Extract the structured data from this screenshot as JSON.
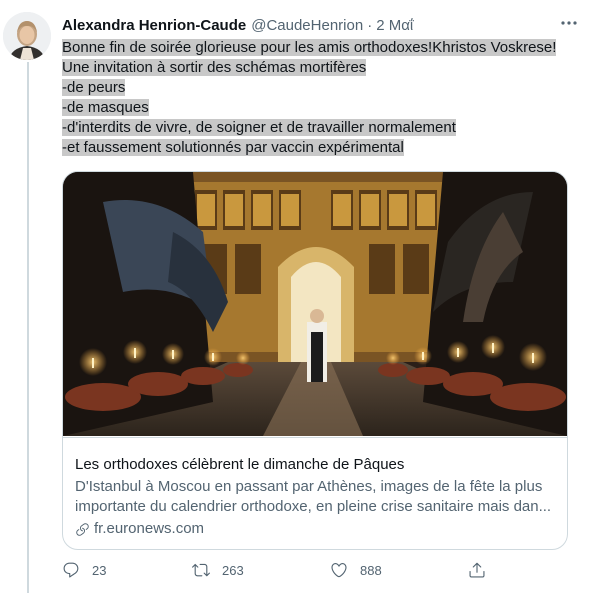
{
  "tweet": {
    "author_name": "Alexandra Henrion-Caude",
    "author_handle": "@CaudeHenrion",
    "separator": "·",
    "date": "2 Μαΐ",
    "text_lines": [
      "Bonne fin de soirée glorieuse pour les amis orthodoxes!Khristos Voskrese!",
      "Une invitation à sortir des schémas mortifères",
      "-de peurs",
      "-de masques",
      "-d'interdits de vivre, de soigner et de travailler normalement",
      "-et faussement solutionnés par vaccin expérimental"
    ]
  },
  "card": {
    "title": "Les orthodoxes célèbrent le dimanche de Pâques",
    "description": "D'Istanbul à Moscou en passant par Athènes, images de la fête la plus importante du calendrier orthodoxe, en pleine crise sanitaire mais dan...",
    "domain": "fr.euronews.com"
  },
  "actions": {
    "reply_count": "23",
    "retweet_count": "263",
    "like_count": "888"
  },
  "icons": {
    "more": "more-icon",
    "link": "link-icon",
    "reply": "reply-icon",
    "retweet": "retweet-icon",
    "like": "like-icon",
    "share": "share-icon"
  },
  "colors": {
    "text": "#0f1419",
    "secondary": "#536471",
    "border": "#cfd9de",
    "highlight": "#c8c8c8"
  }
}
